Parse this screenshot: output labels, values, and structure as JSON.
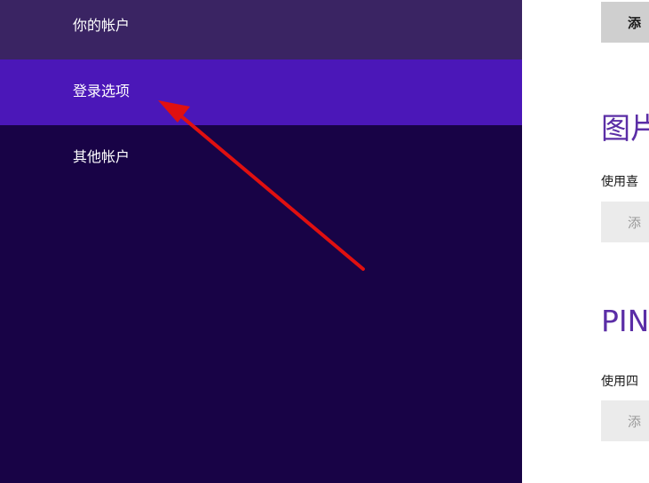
{
  "sidebar": {
    "items": [
      {
        "label": "你的帐户"
      },
      {
        "label": "登录选项"
      },
      {
        "label": "其他帐户"
      }
    ]
  },
  "content": {
    "top_button_label": "添",
    "picture_password": {
      "title": "图片",
      "description": "使用喜",
      "button_label": "添"
    },
    "pin": {
      "title": "PIN",
      "description": "使用四",
      "button_label": "添"
    }
  },
  "colors": {
    "sidebar_bg": "#180346",
    "selected_bg": "#4b17b8",
    "account_bg": "#3a2463",
    "accent": "#5b2ea6",
    "annotation_arrow": "#e01010"
  }
}
